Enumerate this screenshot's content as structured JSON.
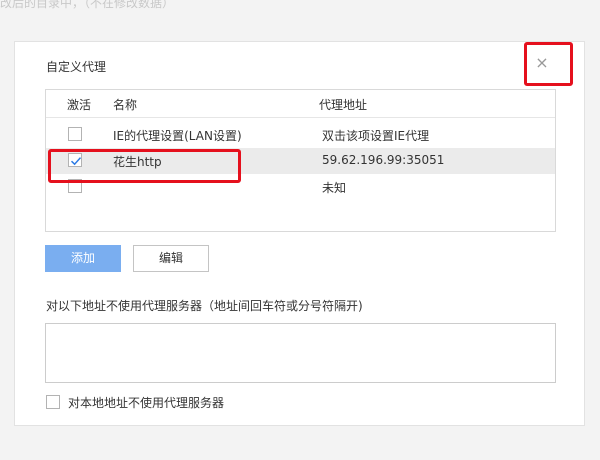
{
  "background": {
    "text": "改后的目录中，（不在修改数据）"
  },
  "dialog": {
    "title": "自定义代理",
    "close_glyph": "×",
    "table": {
      "headers": {
        "active": "激活",
        "name": "名称",
        "address": "代理地址"
      },
      "rows": [
        {
          "active": false,
          "name": "IE的代理设置(LAN设置)",
          "address": "双击该项设置IE代理"
        },
        {
          "active": true,
          "name": "花生http",
          "address": "59.62.196.99:35051",
          "selected": true
        },
        {
          "active": false,
          "name": "",
          "address": "未知"
        }
      ]
    },
    "buttons": {
      "add": "添加",
      "edit": "编辑"
    },
    "bypass": {
      "label": "对以下地址不使用代理服务器（地址间回车符或分号符隔开)",
      "value": ""
    },
    "local_bypass": {
      "label": "对本地地址不使用代理服务器",
      "checked": false
    }
  },
  "colors": {
    "highlight": "#e5101d",
    "primary": "#7aaef0",
    "check": "#2d7be5"
  }
}
